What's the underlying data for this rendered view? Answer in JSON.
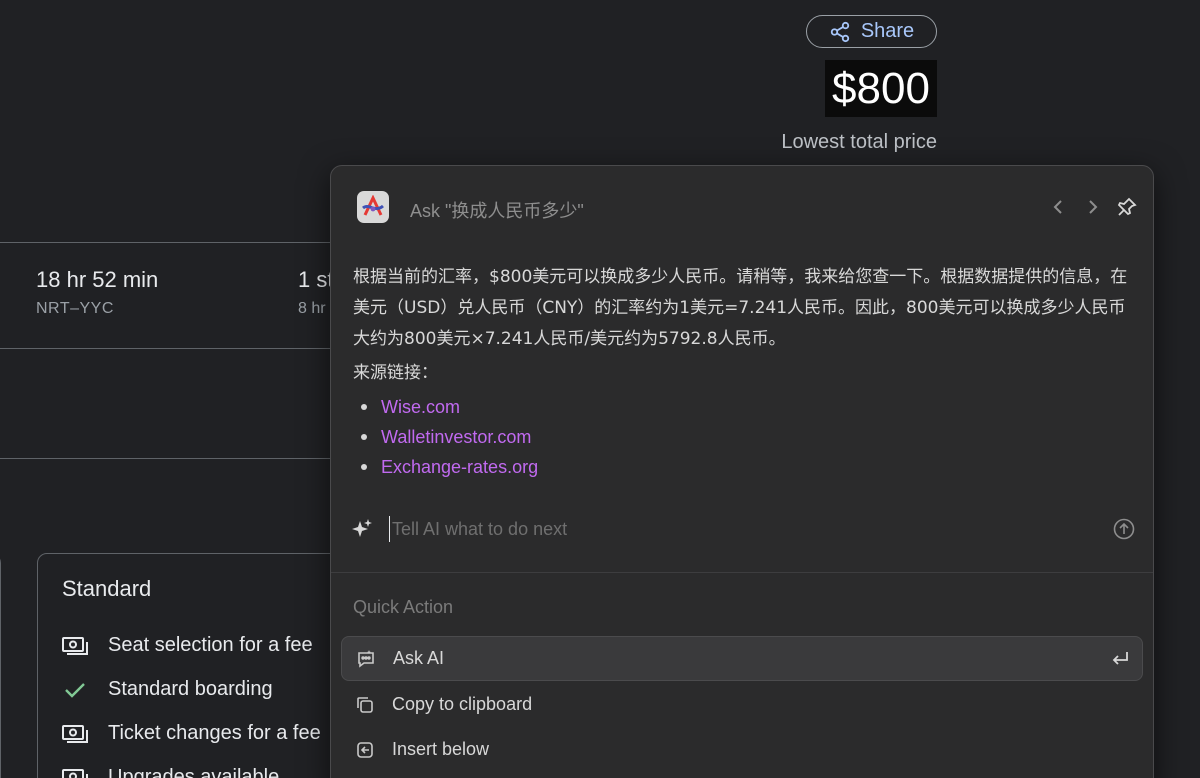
{
  "share": {
    "label": "Share",
    "icon": "share-icon"
  },
  "price": {
    "value": "$800",
    "caption": "Lowest total price"
  },
  "flight": {
    "duration": "18 hr 52 min",
    "route": "NRT–YYC",
    "stops": "1 st",
    "stops_sub": "8 hr"
  },
  "fare": {
    "title": "Standard",
    "features": [
      {
        "icon": "ticket-icon",
        "label": "Seat selection for a fee"
      },
      {
        "icon": "check-icon",
        "label": "Standard boarding"
      },
      {
        "icon": "ticket-icon",
        "label": "Ticket changes for a fee"
      },
      {
        "icon": "ticket-icon",
        "label": "Upgrades available"
      }
    ]
  },
  "popup": {
    "ask_title": "Ask \"换成人民币多少\"",
    "answer": "根据当前的汇率，$800美元可以换成多少人民币。请稍等，我来给您查一下。根据数据提供的信息，在美元（USD）兑人民币（CNY）的汇率约为1美元=7.241人民币。因此，800美元可以换成多少人民币大约为800美元×7.241人民币/美元约为5792.8人民币。",
    "sources_label": "来源链接：",
    "sources": [
      "Wise.com",
      "Walletinvestor.com",
      "Exchange-rates.org"
    ],
    "link_color": "#c16af0",
    "input_placeholder": "Tell AI what to do next",
    "quick_action_label": "Quick Action",
    "quick_actions": [
      {
        "label": "Ask AI",
        "icon": "ai-chat-icon"
      },
      {
        "label": "Copy to clipboard",
        "icon": "copy-icon"
      },
      {
        "label": "Insert below",
        "icon": "insert-below-icon"
      }
    ]
  }
}
